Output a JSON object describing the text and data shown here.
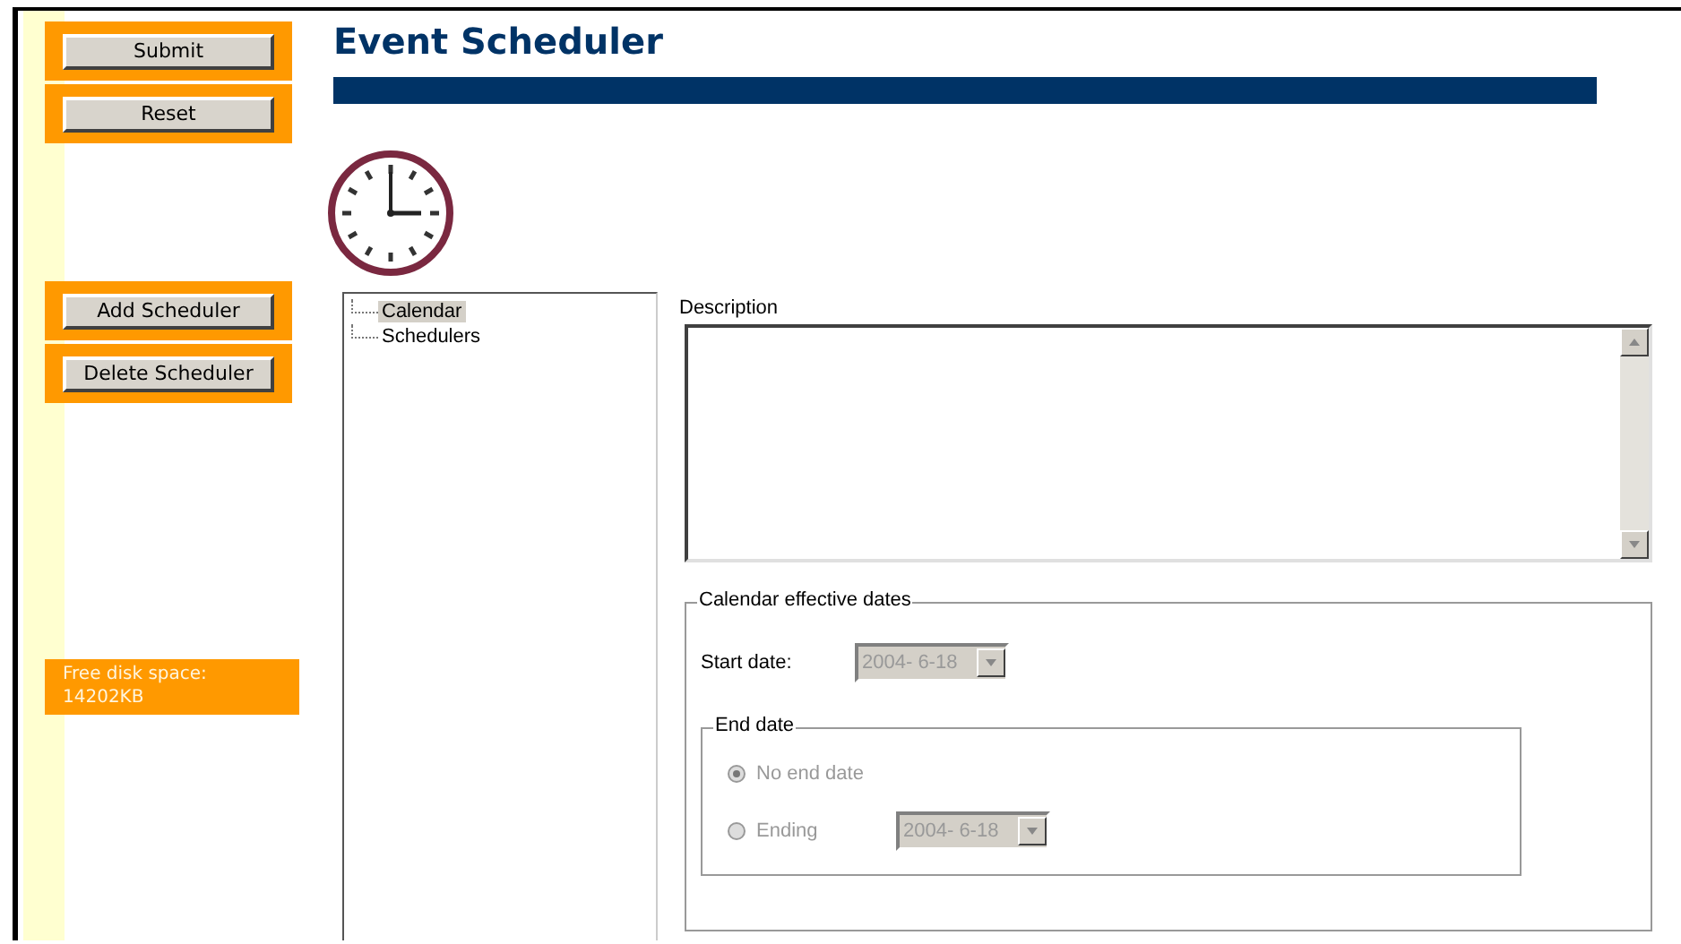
{
  "sidebar": {
    "form_buttons": [
      {
        "label": "Submit"
      },
      {
        "label": "Reset"
      }
    ],
    "scheduler_buttons": [
      {
        "label": "Add Scheduler"
      },
      {
        "label": "Delete Scheduler"
      }
    ],
    "free_disk_space": {
      "label": "Free disk space:",
      "value": "14202KB"
    }
  },
  "title": "Event Scheduler",
  "tree": {
    "items": [
      {
        "label": "Calendar",
        "selected": true
      },
      {
        "label": "Schedulers",
        "selected": false
      }
    ]
  },
  "description": {
    "label": "Description"
  },
  "effective_dates": {
    "legend": "Calendar effective dates",
    "start_date": {
      "label": "Start date:",
      "value": "2004- 6-18",
      "disabled": true
    },
    "end_date": {
      "legend": "End date",
      "options": [
        {
          "label": "No end date",
          "selected": true,
          "disabled": true
        },
        {
          "label": "Ending",
          "selected": false,
          "disabled": true,
          "value": "2004- 6-18"
        }
      ]
    }
  }
}
